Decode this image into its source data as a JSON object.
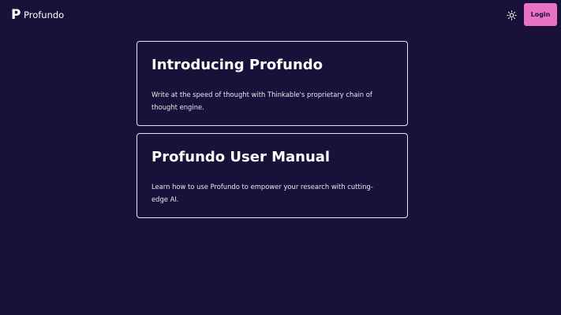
{
  "header": {
    "logo_glyph": "P",
    "brand_name": "Profundo",
    "theme_icon": "sun-icon",
    "login_label": "Login"
  },
  "cards": [
    {
      "title": "Introducing Profundo",
      "description": "Write at the speed of thought with Thinkable's proprietary chain of thought engine."
    },
    {
      "title": "Profundo User Manual",
      "description": "Learn how to use Profundo to empower your research with cutting-edge AI."
    }
  ],
  "colors": {
    "background": "#19113a",
    "accent": "#e873c6",
    "card_border": "#e6e3ee",
    "text": "#ffffff"
  }
}
